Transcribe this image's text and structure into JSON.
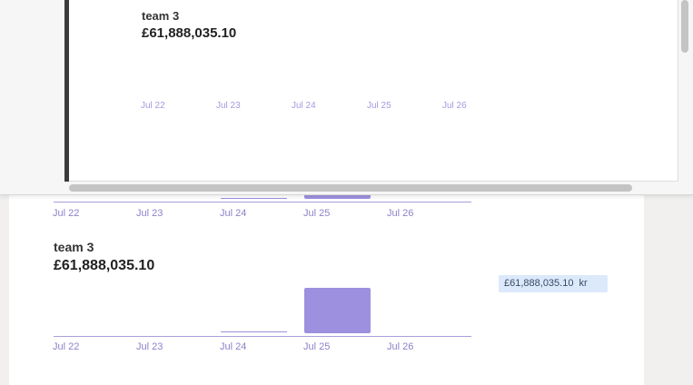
{
  "overlay": {
    "team": "team 3",
    "amount": "£61,888,035.10",
    "ticks": [
      "Jul 22",
      "Jul 23",
      "Jul 24",
      "Jul 25",
      "Jul 26"
    ]
  },
  "upper_chart": {
    "ticks": [
      "Jul 22",
      "Jul 23",
      "Jul 24",
      "Jul 25",
      "Jul 26"
    ]
  },
  "lower_chart": {
    "team": "team 3",
    "amount": "£61,888,035.10",
    "ticks": [
      "Jul 22",
      "Jul 23",
      "Jul 24",
      "Jul 25",
      "Jul 26"
    ]
  },
  "badge": {
    "amount": "£61,888,035.10",
    "currency": "kr"
  },
  "colors": {
    "bar": "#9d90df",
    "badge_bg": "#dbe9fb",
    "tick": "#8b82c8"
  }
}
